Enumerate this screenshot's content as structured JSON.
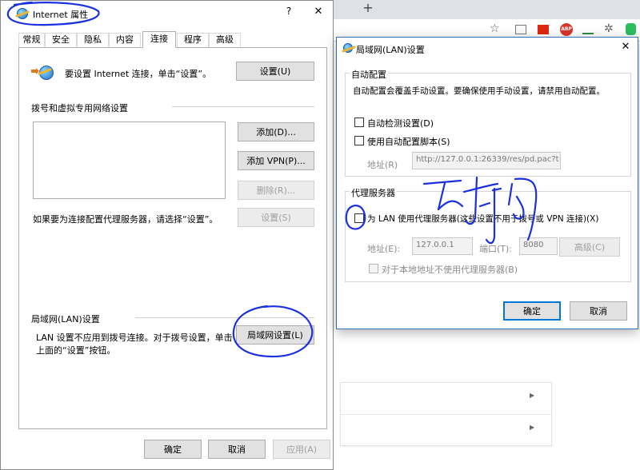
{
  "browser": {
    "new_tab_glyph": "+"
  },
  "inet": {
    "title": "Internet 属性",
    "help_glyph": "?",
    "close_glyph": "✕",
    "tabs": [
      {
        "label": "常规"
      },
      {
        "label": "安全"
      },
      {
        "label": "隐私"
      },
      {
        "label": "内容"
      },
      {
        "label": "连接",
        "active": true
      },
      {
        "label": "程序"
      },
      {
        "label": "高级"
      }
    ],
    "setup_text": "要设置 Internet 连接，单击“设置”。",
    "setup_button": "设置(U)",
    "dialup_section": "拨号和虚拟专用网络设置",
    "add_button": "添加(D)...",
    "add_vpn_button": "添加 VPN(P)...",
    "remove_button": "删除(R)...",
    "proxy_hint": "如果要为连接配置代理服务器，请选择“设置”。",
    "settings_button": "设置(S)",
    "lan_section": "局域网(LAN)设置",
    "lan_text_1": "LAN 设置不应用到拨号连接。对于拨号设置，单击",
    "lan_text_2": "上面的“设置”按钮。",
    "lan_button": "局域网设置(L)",
    "ok": "确定",
    "cancel": "取消",
    "apply": "应用(A)"
  },
  "lan": {
    "title": "局域网(LAN)设置",
    "close_glyph": "✕",
    "auto_section": "自动配置",
    "auto_desc": "自动配置会覆盖手动设置。要确保使用手动设置，请禁用自动配置。",
    "auto_detect": "自动检测设置(D)",
    "use_script": "使用自动配置脚本(S)",
    "address_label": "地址(R)",
    "script_address": "http://127.0.0.1:26339/res/pd.pac?t=",
    "proxy_section": "代理服务器",
    "use_proxy": "为 LAN 使用代理服务器(这些设置不用于拨号或 VPN 连接)(X)",
    "proxy_addr_label": "地址(E):",
    "proxy_addr": "127.0.0.1",
    "port_label": "端口(T):",
    "port": "8080",
    "advanced_button": "高级(C)",
    "bypass_local": "对于本地地址不使用代理服务器(B)",
    "ok": "确定",
    "cancel": "取消"
  },
  "annotation": {
    "handwriting": "不打勾"
  },
  "colors": {
    "ink": "#1b31e0",
    "accent": "#0078d7"
  }
}
